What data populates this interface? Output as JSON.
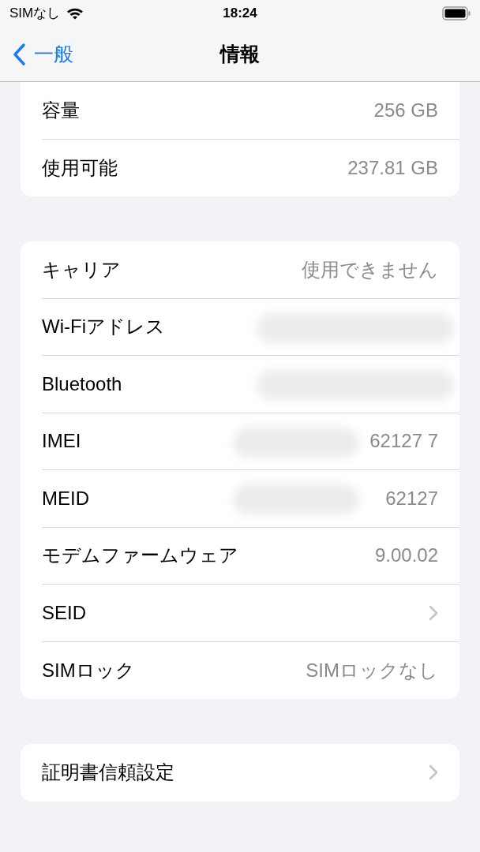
{
  "status_bar": {
    "carrier": "SIMなし",
    "time": "18:24"
  },
  "nav": {
    "back": "一般",
    "title": "情報"
  },
  "groups": [
    {
      "rows": [
        {
          "label": "容量",
          "value": "256 GB",
          "kind": "value",
          "redacted": false
        },
        {
          "label": "使用可能",
          "value": "237.81 GB",
          "kind": "value",
          "redacted": false
        }
      ]
    },
    {
      "rows": [
        {
          "label": "キャリア",
          "value": "使用できません",
          "kind": "value",
          "redacted": false
        },
        {
          "label": "Wi-Fiアドレス",
          "kind": "value",
          "redacted": true
        },
        {
          "label": "Bluetooth",
          "kind": "value",
          "redacted": true
        },
        {
          "label": "IMEI",
          "value": "62127 7",
          "kind": "value",
          "redacted": true
        },
        {
          "label": "MEID",
          "value": "62127",
          "kind": "value",
          "redacted": true
        },
        {
          "label": "モデムファームウェア",
          "value": "9.00.02",
          "kind": "value",
          "redacted": false
        },
        {
          "label": "SEID",
          "kind": "chevron",
          "redacted": false
        },
        {
          "label": "SIMロック",
          "value": "SIMロックなし",
          "kind": "value",
          "redacted": false
        }
      ]
    },
    {
      "rows": [
        {
          "label": "証明書信頼設定",
          "kind": "chevron",
          "redacted": false
        }
      ]
    }
  ]
}
